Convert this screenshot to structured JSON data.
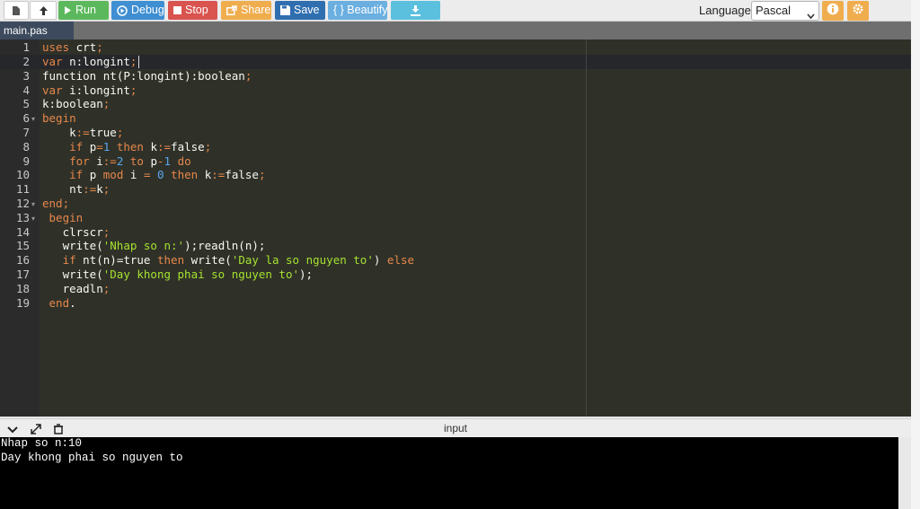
{
  "toolbar": {
    "run": "Run",
    "debug": "Debug",
    "stop": "Stop",
    "share": "Share",
    "save": "Save",
    "beautify": "{ } Beautify",
    "language_label": "Language",
    "language_value": "Pascal",
    "icons": [
      "file-icon",
      "upload-icon",
      "play-icon",
      "debug-icon",
      "stop-icon",
      "share-icon",
      "save-icon",
      "download-icon",
      "info-icon",
      "gear-icon"
    ]
  },
  "tab": {
    "name": "main.pas"
  },
  "editor": {
    "line_numbers": [
      "1",
      "2",
      "3",
      "4",
      "5",
      "6",
      "7",
      "8",
      "9",
      "10",
      "11",
      "12",
      "13",
      "14",
      "15",
      "16",
      "17",
      "18",
      "19"
    ],
    "lines": [
      "uses crt;",
      "var n:longint;",
      "function nt(P:longint):boolean;",
      "var i:longint;",
      "k:boolean;",
      "begin",
      "    k:=true;",
      "    if p=1 then k:=false;",
      "    for i:=2 to p-1 do",
      "    if p mod i = 0 then k:=false;",
      "    nt:=k;",
      "end;",
      " begin",
      "   clrscr;",
      "   write('Nhap so n:');readln(n);",
      "   if nt(n)=true then write('Day la so nguyen to') else",
      "   write('Day khong phai so nguyen to');",
      "   readln;",
      " end."
    ]
  },
  "console": {
    "label": "input",
    "output": [
      "Nhap so n:10",
      "Day khong phai so nguyen to"
    ]
  },
  "colors": {
    "keyword": "#e6874a",
    "string": "#a6e22e",
    "number": "#5aa7f0",
    "editor_bg": "#2f3129"
  }
}
